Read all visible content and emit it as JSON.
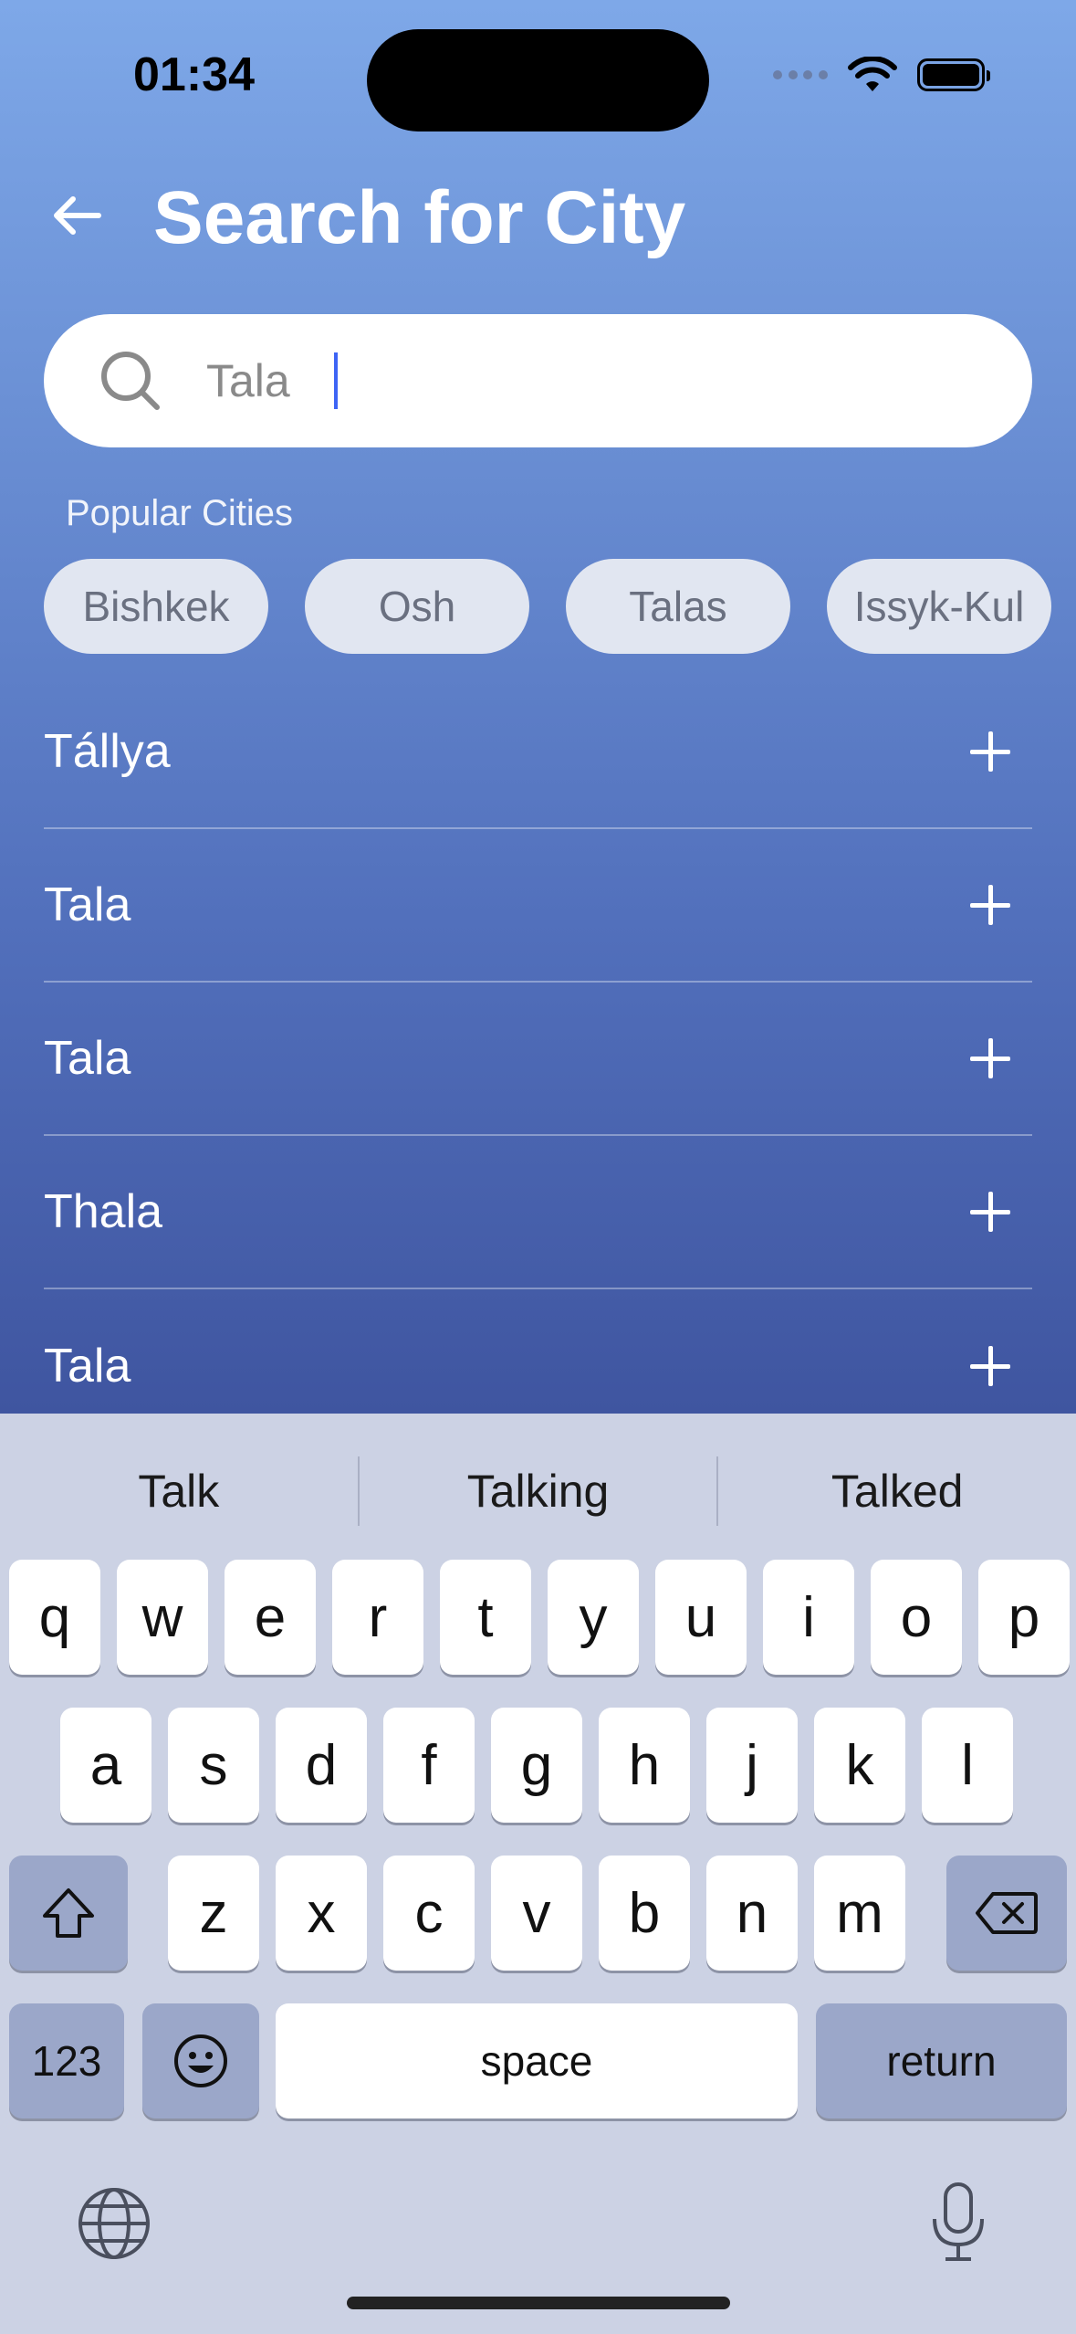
{
  "status_bar": {
    "time": "01:34"
  },
  "header": {
    "title": "Search for City"
  },
  "search": {
    "value": "Tala",
    "placeholder": ""
  },
  "popular": {
    "label": "Popular Cities",
    "cities": [
      "Bishkek",
      "Osh",
      "Talas",
      "Issyk-Kul"
    ]
  },
  "results": [
    "Tállya",
    "Tala",
    "Tala",
    "Thala",
    "Tala"
  ],
  "keyboard": {
    "suggestions": [
      "Talk",
      "Talking",
      "Talked"
    ],
    "row1": [
      "q",
      "w",
      "e",
      "r",
      "t",
      "y",
      "u",
      "i",
      "o",
      "p"
    ],
    "row2": [
      "a",
      "s",
      "d",
      "f",
      "g",
      "h",
      "j",
      "k",
      "l"
    ],
    "row3": [
      "z",
      "x",
      "c",
      "v",
      "b",
      "n",
      "m"
    ],
    "numbers_label": "123",
    "space_label": "space",
    "return_label": "return"
  },
  "colors": {
    "accent_caret": "#3d64f5",
    "gradient_top": "#7ea8e8",
    "gradient_bottom": "#3f55a0"
  }
}
